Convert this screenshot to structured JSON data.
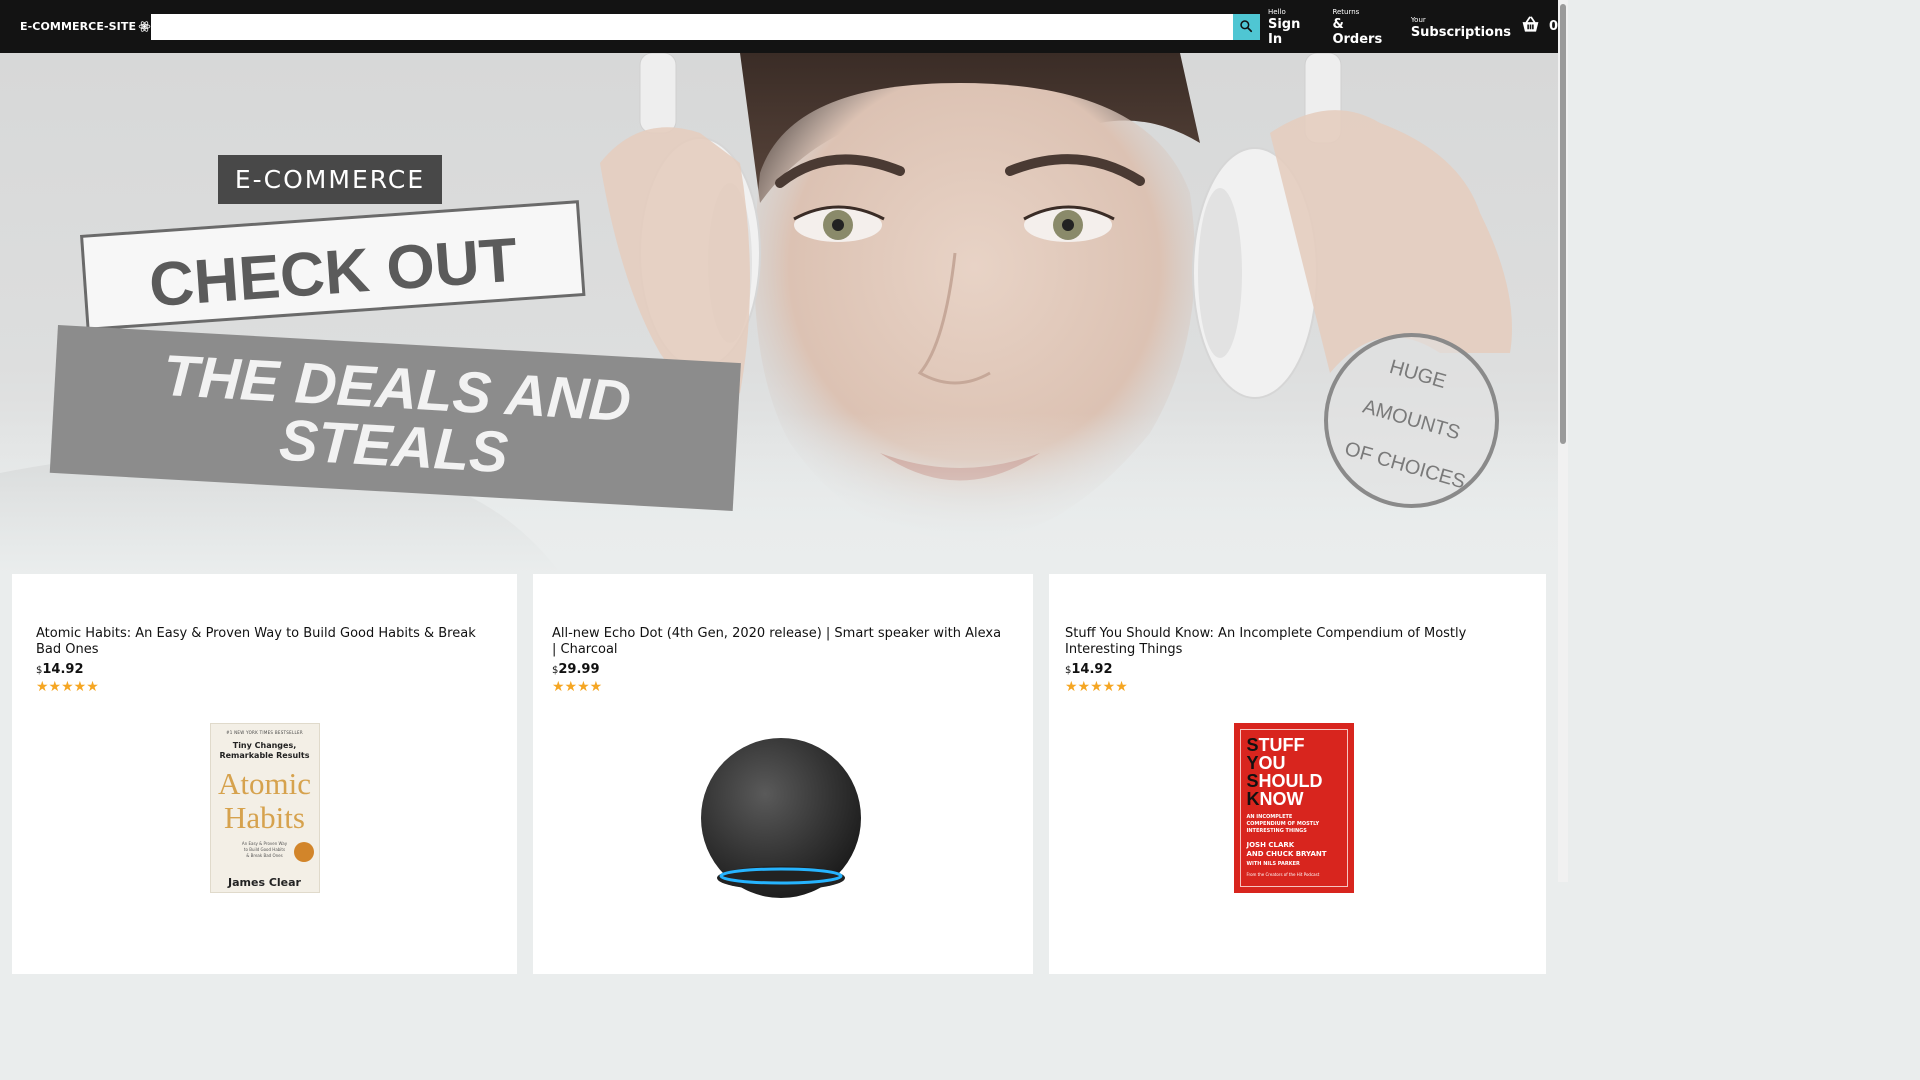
{
  "header": {
    "logo_text": "E-COMMERCE-SITE",
    "logo_icon": "react-atom-icon",
    "search": {
      "value": "",
      "placeholder": "",
      "icon": "search-icon"
    },
    "nav": [
      {
        "line1": "Hello",
        "line2": "Sign In"
      },
      {
        "line1": "Returns",
        "line2": "& Orders"
      },
      {
        "line1": "Your",
        "line2": "Subscriptions"
      }
    ],
    "basket": {
      "icon": "basket-icon",
      "count": "0"
    }
  },
  "hero": {
    "tag": "E-COMMERCE",
    "headline_1": "CHECK OUT",
    "headline_2_line1": "THE DEALS AND",
    "headline_2_line2": "STEALS",
    "badge_line1": "HUGE",
    "badge_line2": "AMOUNTS",
    "badge_line3": "OF CHOICES"
  },
  "products": [
    {
      "title": "Atomic Habits: An Easy & Proven Way to Build Good Habits & Break Bad Ones",
      "currency": "$",
      "price": "14.92",
      "rating": 5,
      "stars": "★★★★★",
      "cover": {
        "top": "#1 NEW YORK TIMES BESTSELLER",
        "subtitle_1": "Tiny Changes,",
        "subtitle_2": "Remarkable Results",
        "title_1": "Atomic",
        "title_2": "Habits",
        "desc_1": "An Easy & Proven Way",
        "desc_2": "to Build Good Habits",
        "desc_3": "& Break Bad Ones",
        "author": "James Clear"
      }
    },
    {
      "title": "All-new Echo Dot (4th Gen, 2020 release) | Smart speaker with Alexa | Charcoal",
      "currency": "$",
      "price": "29.99",
      "rating": 4,
      "stars": "★★★★"
    },
    {
      "title": "Stuff You Should Know: An Incomplete Compendium of Mostly Interesting Things",
      "currency": "$",
      "price": "14.92",
      "rating": 5,
      "stars": "★★★★★",
      "cover": {
        "t1_first": "S",
        "t1_rest": "TUFF",
        "t2_first": "Y",
        "t2_rest": "OU",
        "t3_first": "S",
        "t3_rest": "HOULD",
        "t4_first": "K",
        "t4_rest": "NOW",
        "sub_1": "AN INCOMPLETE",
        "sub_2": "COMPENDIUM OF MOSTLY",
        "sub_3": "INTERESTING THINGS",
        "author_1": "JOSH CLARK",
        "author_2": "AND CHUCK BRYANT",
        "author_3": "WITH NILS PARKER",
        "footer": "From the Creators of the Hit Podcast"
      }
    }
  ],
  "colors": {
    "header_bg": "#131313",
    "search_button": "#4fc6d3",
    "star": "#f5a623",
    "page_bg": "#eaeded"
  }
}
